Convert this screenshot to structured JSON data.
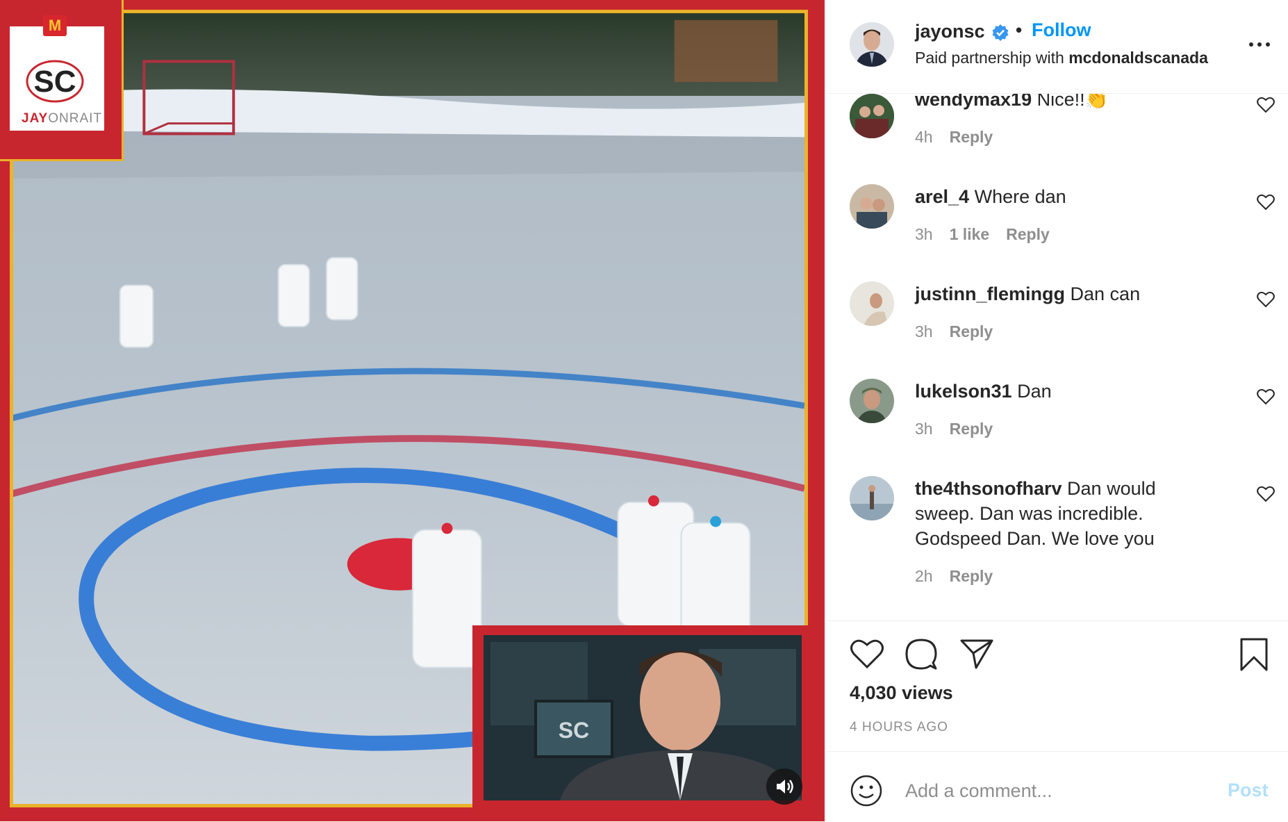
{
  "post": {
    "author": "jayonsc",
    "separator": "•",
    "follow_label": "Follow",
    "partnership_prefix": "Paid partnership with",
    "partner": "mcdonaldscanada",
    "views": "4,030 views",
    "time": "4 HOURS AGO"
  },
  "media": {
    "logo_badge": "M",
    "logo_word_bold": "JAY",
    "logo_word_light": "ONRAIT",
    "pip_logo": "SC"
  },
  "comments": [
    {
      "user": "wendymax19",
      "text": "Nice!!👏",
      "time": "4h",
      "likes": "",
      "reply": "Reply"
    },
    {
      "user": "arel_4",
      "text": "Where dan",
      "time": "3h",
      "likes": "1 like",
      "reply": "Reply"
    },
    {
      "user": "justinn_flemingg",
      "text": "Dan can",
      "time": "3h",
      "likes": "",
      "reply": "Reply"
    },
    {
      "user": "lukelson31",
      "text": "Dan",
      "time": "3h",
      "likes": "",
      "reply": "Reply"
    },
    {
      "user": "the4thsonofharv",
      "text": "Dan would sweep. Dan was incredible. Godspeed Dan. We love you",
      "time": "2h",
      "likes": "",
      "reply": "Reply"
    }
  ],
  "comment_box": {
    "placeholder": "Add a comment...",
    "post_label": "Post"
  },
  "colors": {
    "accent": "#0095f6",
    "post_disabled": "#b2dffc",
    "frame_red": "#c8262e",
    "frame_gold": "#e9b32a"
  },
  "icons": [
    "verified-icon",
    "more-options-icon",
    "heart-icon",
    "comment-icon",
    "share-icon",
    "bookmark-icon",
    "emoji-icon",
    "sound-icon"
  ]
}
